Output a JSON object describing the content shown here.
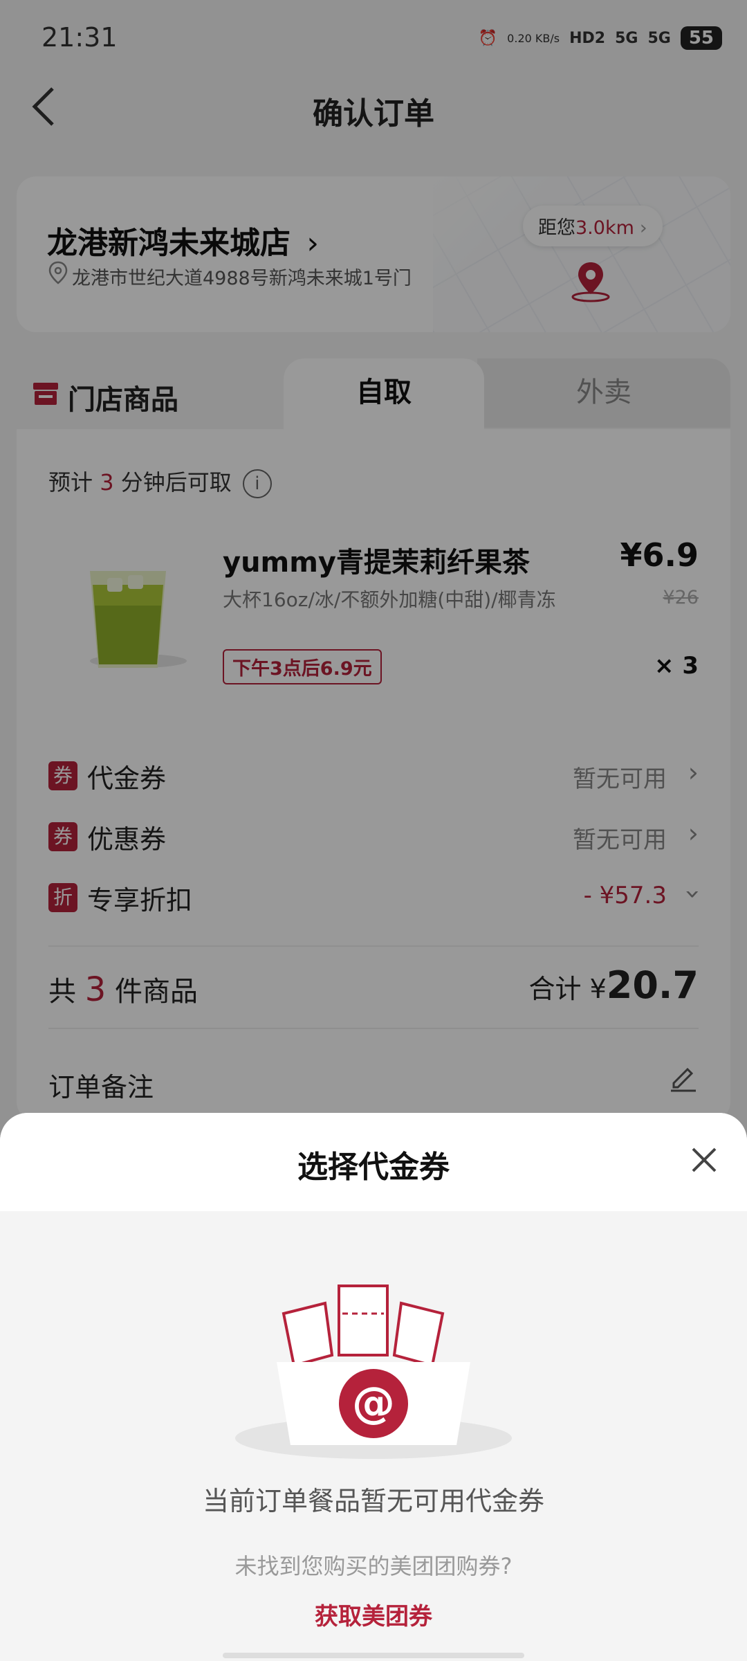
{
  "status_bar": {
    "time": "21:31",
    "net_speed": "0.20 KB/s",
    "hd": "HD2",
    "sig1": "5G",
    "sig2": "5G",
    "battery": "55"
  },
  "nav": {
    "title": "确认订单"
  },
  "store": {
    "name": "龙港新鸿未来城店",
    "address": "龙港市世纪大道4988号新鸿未来城1号门",
    "distance_prefix": "距您",
    "distance_value": "3.0km"
  },
  "tabs": {
    "store_goods": "门店商品",
    "self_pickup": "自取",
    "delivery": "外卖"
  },
  "order": {
    "pickup_prefix": "预计",
    "pickup_minutes": "3",
    "pickup_suffix": "分钟后可取",
    "product": {
      "name": "yummy青提茉莉纤果茶",
      "spec": "大杯16oz/冰/不额外加糖(中甜)/椰青冻",
      "price": "¥6.9",
      "original_price": "¥26",
      "promo": "下午3点后6.9元",
      "quantity": "× 3"
    },
    "rows": [
      {
        "badge": "券",
        "label": "代金券",
        "value": "暂无可用"
      },
      {
        "badge": "券",
        "label": "优惠券",
        "value": "暂无可用"
      },
      {
        "badge": "折",
        "label": "专享折扣",
        "value": "- ¥57.3"
      }
    ],
    "count_prefix": "共",
    "count": "3",
    "count_suffix": "件商品",
    "total_label": "合计",
    "total_currency": "¥",
    "total_value": "20.7",
    "remark_label": "订单备注"
  },
  "sheet": {
    "title": "选择代金券",
    "empty_message": "当前订单餐品暂无可用代金券",
    "hint": "未找到您购买的美团团购券?",
    "get_link": "获取美团券"
  },
  "colors": {
    "accent": "#b5223b"
  }
}
